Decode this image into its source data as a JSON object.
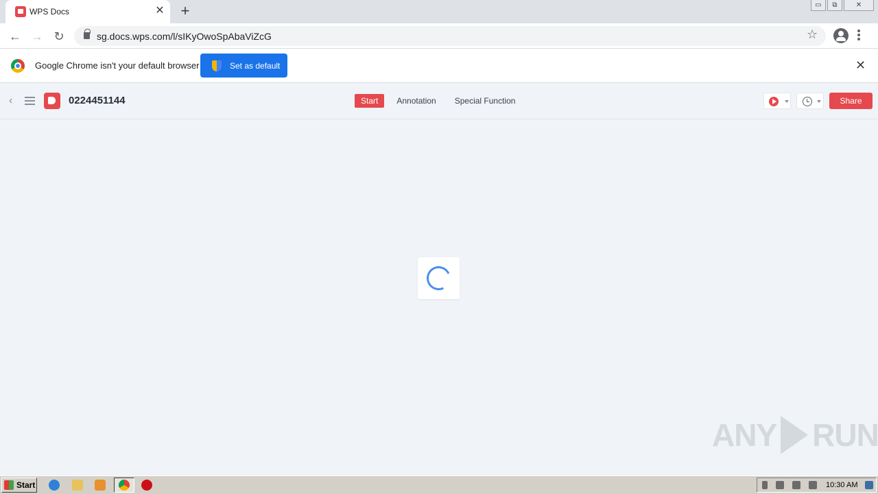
{
  "browser": {
    "tab": {
      "title": "WPS Docs",
      "close": "✕"
    },
    "new_tab": "+",
    "window_controls": {
      "minimize": "▭",
      "restore": "⧉",
      "close": "✕"
    },
    "url": "sg.docs.wps.com/l/sIKyOwoSpAbaViZcG",
    "back": "←",
    "forward": "→",
    "reload": "↻",
    "star": "☆"
  },
  "infobar": {
    "message": "Google Chrome isn't your default browser",
    "button": "Set as default",
    "close": "✕"
  },
  "wps": {
    "back": "‹",
    "doc_title": "0224451144",
    "tabs": [
      {
        "label": "Start",
        "active": true
      },
      {
        "label": "Annotation",
        "active": false
      },
      {
        "label": "Special Function",
        "active": false
      }
    ],
    "share": "Share"
  },
  "watermark": {
    "left": "ANY",
    "right": "RUN"
  },
  "taskbar": {
    "start": "Start",
    "clock": "10:30 AM"
  },
  "colors": {
    "wps_red": "#e5484d",
    "chrome_blue": "#1a73e8",
    "spinner_blue": "#4a8fe7"
  }
}
